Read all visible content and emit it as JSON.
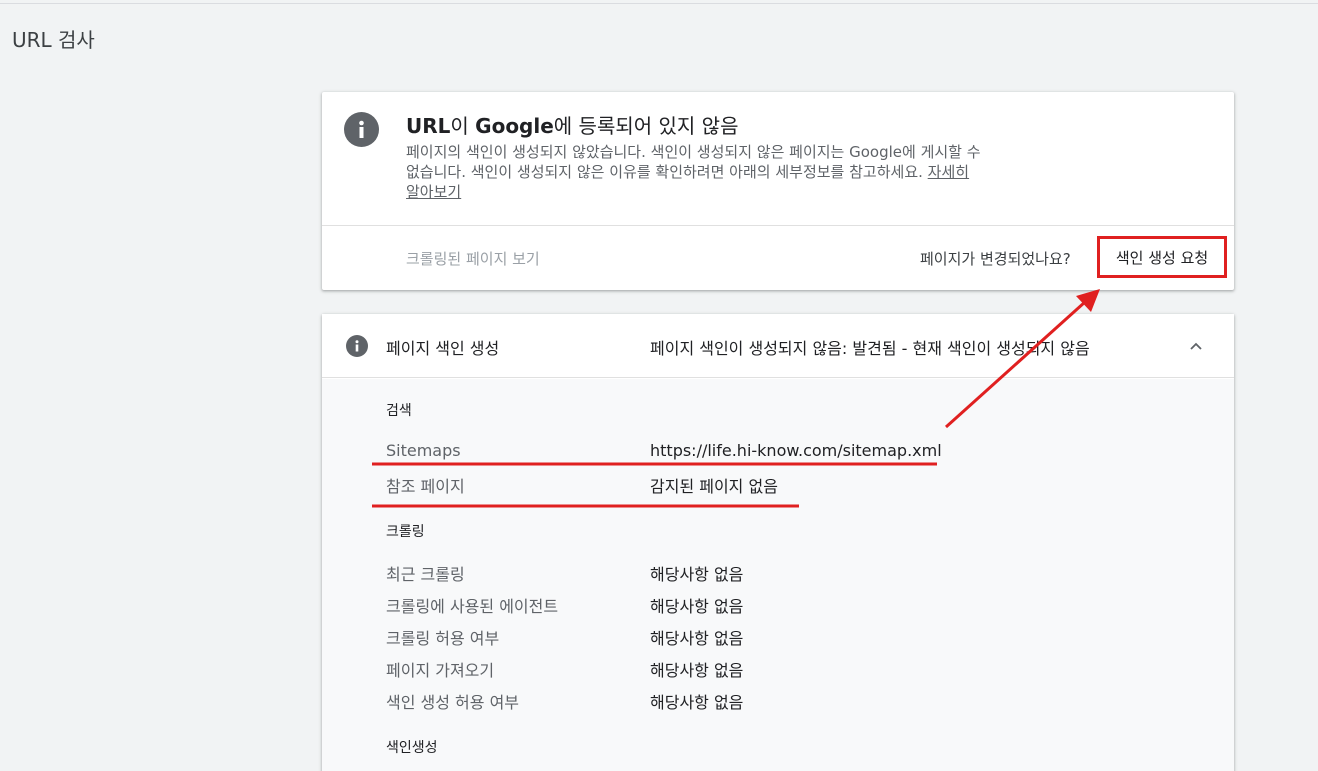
{
  "page": {
    "title": "URL 검사"
  },
  "status_card": {
    "title_prefix": "URL",
    "title_mid": "이 ",
    "title_brand": "Google",
    "title_suffix": "에 등록되어 있지 않음",
    "description": "페이지의 색인이 생성되지 않았습니다. 색인이 생성되지 않은 페이지는 Google에 게시할 수 없습니다. 색인이 생성되지 않은 이유를 확인하려면 아래의 세부정보를 참고하세요.",
    "learn_more": "자세히 알아보기",
    "crawled_page_link": "크롤링된 페이지 보기",
    "changed_question": "페이지가 변경되었나요?",
    "request_indexing": "색인 생성 요청",
    "icon": "info-icon"
  },
  "detail_card": {
    "label": "페이지 색인 생성",
    "status": "페이지 색인이 생성되지 않음: 발견됨 - 현재 색인이 생성되지 않음",
    "icon": "info-icon",
    "toggle_icon": "chevron-up-icon",
    "sections": {
      "search": {
        "heading": "검색",
        "rows": [
          {
            "key": "Sitemaps",
            "value": "https://life.hi-know.com/sitemap.xml"
          },
          {
            "key": "참조 페이지",
            "value": "감지된 페이지 없음"
          }
        ]
      },
      "crawl": {
        "heading": "크롤링",
        "rows": [
          {
            "key": "최근 크롤링",
            "value": "해당사항 없음"
          },
          {
            "key": "크롤링에 사용된 에이전트",
            "value": "해당사항 없음"
          },
          {
            "key": "크롤링 허용 여부",
            "value": "해당사항 없음"
          },
          {
            "key": "페이지 가져오기",
            "value": "해당사항 없음"
          },
          {
            "key": "색인 생성 허용 여부",
            "value": "해당사항 없음"
          }
        ]
      },
      "indexing": {
        "heading": "색인생성"
      }
    }
  },
  "annotations": {
    "color": "#e02020"
  }
}
